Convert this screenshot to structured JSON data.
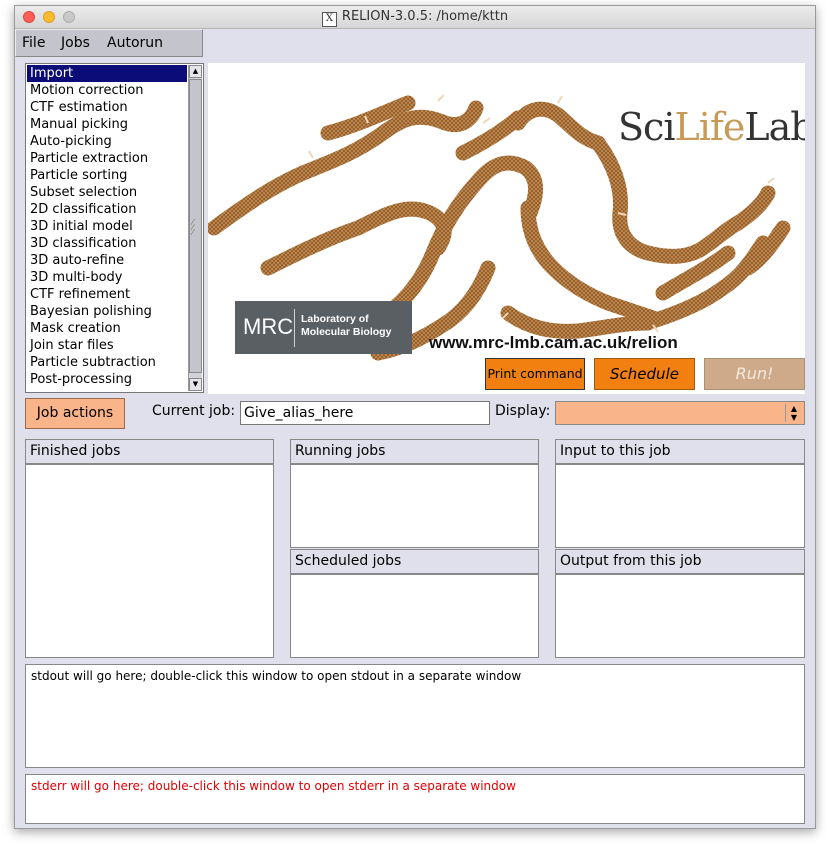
{
  "window": {
    "title": "RELION-3.0.5: /home/kttn",
    "x_logo": "X"
  },
  "menubar": {
    "items": [
      "File",
      "Jobs",
      "Autorun"
    ]
  },
  "job_types": {
    "selected_index": 0,
    "items": [
      "Import",
      "Motion correction",
      "CTF estimation",
      "Manual picking",
      "Auto-picking",
      "Particle extraction",
      "Particle sorting",
      "Subset selection",
      "2D classification",
      "3D initial model",
      "3D classification",
      "3D auto-refine",
      "3D multi-body",
      "CTF refinement",
      "Bayesian polishing",
      "Mask creation",
      "Join star files",
      "Particle subtraction",
      "Post-processing"
    ]
  },
  "banner": {
    "scilifelab_pre": "Sci",
    "scilifelab_life": "Life",
    "scilifelab_post": "Lab",
    "mrc_short": "MRC",
    "mrc_line1": "Laboratory of",
    "mrc_line2": "Molecular Biology",
    "url": "www.mrc-lmb.cam.ac.uk/relion",
    "structure_color": "#b5793d"
  },
  "buttons": {
    "print": "Print command",
    "schedule": "Schedule",
    "run": "Run!",
    "job_actions": "Job actions"
  },
  "current_job": {
    "label": "Current job:",
    "value": "Give_alias_here"
  },
  "display": {
    "label": "Display:",
    "value": ""
  },
  "panels": {
    "finished": "Finished jobs",
    "running": "Running jobs",
    "scheduled": "Scheduled jobs",
    "input": "Input to this job",
    "output": "Output from this job"
  },
  "logs": {
    "stdout": "stdout will go here; double-click this window to open stdout in a separate window",
    "stderr": "stderr will go here; double-click this window to open stderr in a separate window"
  },
  "colors": {
    "accent_orange": "#f28010",
    "light_orange": "#f9b48a",
    "selection": "#0c0c78",
    "stderr": "#e00000"
  }
}
